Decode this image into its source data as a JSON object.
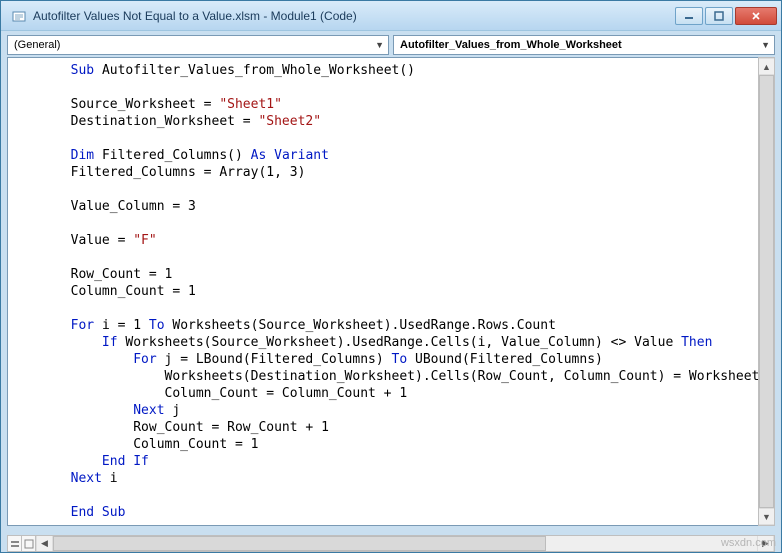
{
  "titlebar": {
    "title": "Autofilter Values Not Equal to a Value.xlsm - Module1 (Code)"
  },
  "dropdowns": {
    "left": "(General)",
    "right": "Autofilter_Values_from_Whole_Worksheet"
  },
  "code": {
    "lines": [
      {
        "indent": 1,
        "tokens": [
          {
            "t": "Sub ",
            "c": "kw"
          },
          {
            "t": "Autofilter_Values_from_Whole_Worksheet()"
          }
        ]
      },
      {
        "indent": 1,
        "tokens": [
          {
            "t": ""
          }
        ]
      },
      {
        "indent": 1,
        "tokens": [
          {
            "t": "Source_Worksheet = "
          },
          {
            "t": "\"Sheet1\"",
            "c": "str"
          }
        ]
      },
      {
        "indent": 1,
        "tokens": [
          {
            "t": "Destination_Worksheet = "
          },
          {
            "t": "\"Sheet2\"",
            "c": "str"
          }
        ]
      },
      {
        "indent": 1,
        "tokens": [
          {
            "t": ""
          }
        ]
      },
      {
        "indent": 1,
        "tokens": [
          {
            "t": "Dim ",
            "c": "kw"
          },
          {
            "t": "Filtered_Columns() "
          },
          {
            "t": "As Variant",
            "c": "kw"
          }
        ]
      },
      {
        "indent": 1,
        "tokens": [
          {
            "t": "Filtered_Columns = Array(1, 3)"
          }
        ]
      },
      {
        "indent": 1,
        "tokens": [
          {
            "t": ""
          }
        ]
      },
      {
        "indent": 1,
        "tokens": [
          {
            "t": "Value_Column = 3"
          }
        ]
      },
      {
        "indent": 1,
        "tokens": [
          {
            "t": ""
          }
        ]
      },
      {
        "indent": 1,
        "tokens": [
          {
            "t": "Value = "
          },
          {
            "t": "\"F\"",
            "c": "str"
          }
        ]
      },
      {
        "indent": 1,
        "tokens": [
          {
            "t": ""
          }
        ]
      },
      {
        "indent": 1,
        "tokens": [
          {
            "t": "Row_Count = 1"
          }
        ]
      },
      {
        "indent": 1,
        "tokens": [
          {
            "t": "Column_Count = 1"
          }
        ]
      },
      {
        "indent": 1,
        "tokens": [
          {
            "t": ""
          }
        ]
      },
      {
        "indent": 1,
        "tokens": [
          {
            "t": "For ",
            "c": "kw"
          },
          {
            "t": "i = 1 "
          },
          {
            "t": "To ",
            "c": "kw"
          },
          {
            "t": "Worksheets(Source_Worksheet).UsedRange.Rows.Count"
          }
        ]
      },
      {
        "indent": 2,
        "tokens": [
          {
            "t": "If ",
            "c": "kw"
          },
          {
            "t": "Worksheets(Source_Worksheet).UsedRange.Cells(i, Value_Column) <> Value "
          },
          {
            "t": "Then",
            "c": "kw"
          }
        ]
      },
      {
        "indent": 3,
        "tokens": [
          {
            "t": "For ",
            "c": "kw"
          },
          {
            "t": "j = LBound(Filtered_Columns) "
          },
          {
            "t": "To ",
            "c": "kw"
          },
          {
            "t": "UBound(Filtered_Columns)"
          }
        ]
      },
      {
        "indent": 4,
        "tokens": [
          {
            "t": "Worksheets(Destination_Worksheet).Cells(Row_Count, Column_Count) = Worksheets(Source_Worksheet"
          }
        ]
      },
      {
        "indent": 4,
        "tokens": [
          {
            "t": "Column_Count = Column_Count + 1"
          }
        ]
      },
      {
        "indent": 3,
        "tokens": [
          {
            "t": "Next ",
            "c": "kw"
          },
          {
            "t": "j"
          }
        ]
      },
      {
        "indent": 3,
        "tokens": [
          {
            "t": "Row_Count = Row_Count + 1"
          }
        ]
      },
      {
        "indent": 3,
        "tokens": [
          {
            "t": "Column_Count = 1"
          }
        ]
      },
      {
        "indent": 2,
        "tokens": [
          {
            "t": "End If",
            "c": "kw"
          }
        ]
      },
      {
        "indent": 1,
        "tokens": [
          {
            "t": "Next ",
            "c": "kw"
          },
          {
            "t": "i"
          }
        ]
      },
      {
        "indent": 1,
        "tokens": [
          {
            "t": ""
          }
        ]
      },
      {
        "indent": 1,
        "tokens": [
          {
            "t": "End Sub",
            "c": "kw"
          }
        ]
      }
    ]
  },
  "watermark": "wsxdn.com"
}
